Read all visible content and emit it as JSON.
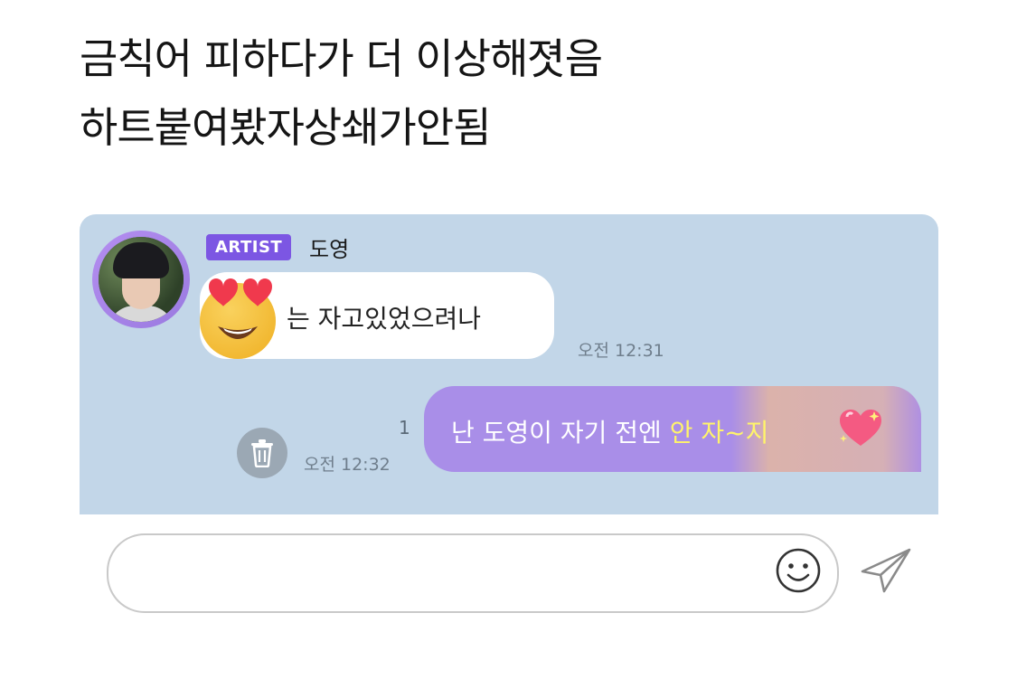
{
  "caption": {
    "line1": "금칙어 피하다가 더 이상해졋음",
    "line2": "하트붙여봤자상쇄가안됨"
  },
  "chat": {
    "incoming": {
      "badge": "ARTIST",
      "sender": "도영",
      "emoji": "heart-eyes-emoji",
      "text": "는 자고있었으려나",
      "time": "오전 12:31"
    },
    "outgoing": {
      "text_plain": "난 도영이 자기 전엔 ",
      "text_highlight": "안 자~지",
      "emoji": "sparkling-heart-emoji",
      "unread_count": "1",
      "time": "오전 12:32"
    }
  },
  "input": {
    "placeholder": "",
    "emoji_icon": "smiley-icon",
    "send_icon": "paper-plane-icon"
  },
  "colors": {
    "chat_bg": "#c2d6e8",
    "badge": "#7c56e3",
    "outgoing_bubble": "#a98ee8",
    "highlight_text": "#fff46a"
  }
}
